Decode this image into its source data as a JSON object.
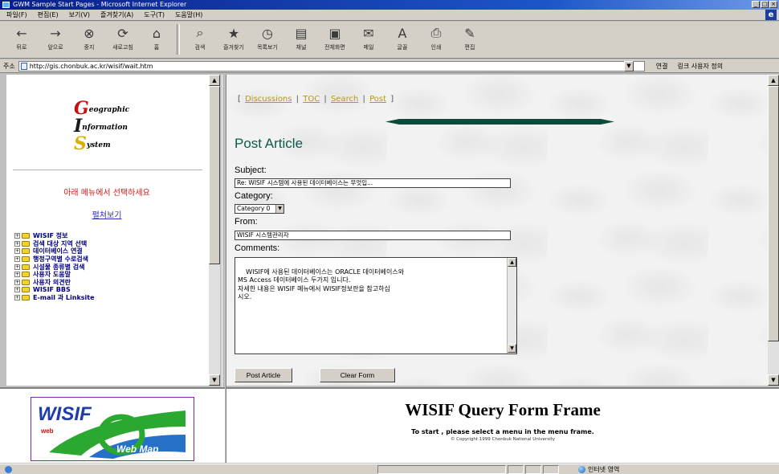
{
  "window": {
    "title": "GWM Sample Start Pages - Microsoft Internet Explorer"
  },
  "menubar": [
    "파일(F)",
    "편집(E)",
    "보기(V)",
    "즐겨찾기(A)",
    "도구(T)",
    "도움말(H)"
  ],
  "toolbar": {
    "buttons": [
      {
        "label": "뒤로",
        "icon": "back-arrow-icon"
      },
      {
        "label": "앞으로",
        "icon": "forward-arrow-icon"
      },
      {
        "label": "중지",
        "icon": "stop-icon"
      },
      {
        "label": "새로고침",
        "icon": "refresh-icon"
      },
      {
        "label": "홈",
        "icon": "home-icon"
      },
      {
        "label": "검색",
        "icon": "search-icon"
      },
      {
        "label": "즐겨찾기",
        "icon": "favorites-icon"
      },
      {
        "label": "목록보기",
        "icon": "history-icon"
      },
      {
        "label": "채널",
        "icon": "channels-icon"
      },
      {
        "label": "전체화면",
        "icon": "fullscreen-icon"
      },
      {
        "label": "메일",
        "icon": "mail-icon"
      },
      {
        "label": "글꼴",
        "icon": "font-icon"
      },
      {
        "label": "인쇄",
        "icon": "print-icon"
      },
      {
        "label": "편집",
        "icon": "edit-icon"
      }
    ]
  },
  "address": {
    "label": "주소",
    "url": "http://gis.chonbuk.ac.kr/wisif/wait.htm",
    "go_label": "연결",
    "links_label": "링크 사용자 정의"
  },
  "left_frame": {
    "logo": {
      "g": "G",
      "g_rest": "eographic",
      "i": "I",
      "i_rest": "nformation",
      "s": "S",
      "s_rest": "ystem"
    },
    "prompt": "아래 메뉴에서 선택하세요",
    "browse_link": "펼쳐보기",
    "tree": [
      "WISIF 정보",
      "검색 대상 지역 선택",
      "데이터베이스 연결",
      "행정구역별 수로검색",
      "시설물 종류별 검색",
      "사용자 도움말",
      "사용자 의견란",
      "WISIF BBS",
      "E-mail 과 Linksite"
    ]
  },
  "right_frame": {
    "nav": {
      "open": "[",
      "links": [
        "Discussions",
        "TOC",
        "Search",
        "Post"
      ],
      "sep": "|",
      "close": "]"
    },
    "title": "Post Article",
    "subject_label": "Subject:",
    "subject_value": "Re: WISIF 시스템에 사용된 데이터베이스는 무엇입...",
    "category_label": "Category:",
    "category_value": "Category 0",
    "from_label": "From:",
    "from_value": "WISIF 시스템관리자",
    "comments_label": "Comments:",
    "comments_value": "WISIF에 사용된 데이터베이스는 ORACLE 데이터베이스와\nMS Access 데이터베이스 두가지 입니다.\n자세한 내용은 WISIF 메뉴에서 WISIF정보란을 참고하십\n시오.",
    "post_button": "Post Article",
    "clear_button": "Clear Form"
  },
  "bottom_left": {
    "logo_text": "WISIF",
    "logo_sub": "web",
    "logo_caption": "Web Map"
  },
  "bottom_right": {
    "title": "WISIF Query Form Frame",
    "subtitle": "To start , please select a menu in the menu frame.",
    "copyright": "© Copyright 1999 Chonbuk National University"
  },
  "statusbar": {
    "zone": "인터넷 영역"
  },
  "colors": {
    "title_green": "#0d5a48",
    "link_gold": "#b89a00",
    "prompt_red": "#d01818",
    "tree_navy": "#000080"
  }
}
